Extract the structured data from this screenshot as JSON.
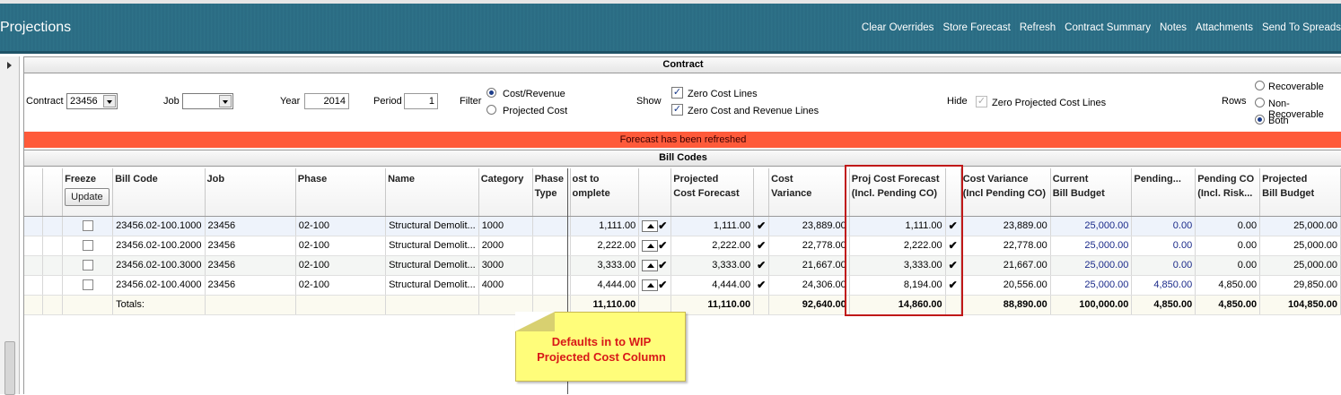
{
  "app": {
    "title": "Projections"
  },
  "header_actions": [
    "Clear Overrides",
    "Store Forecast",
    "Refresh",
    "Contract Summary",
    "Notes",
    "Attachments",
    "Send To Spreads"
  ],
  "contract_section": {
    "title": "Contract",
    "contract_label": "Contract",
    "contract_value": "23456",
    "job_label": "Job",
    "job_value": "",
    "year_label": "Year",
    "year_value": "2014",
    "period_label": "Period",
    "period_value": "1",
    "filter_label": "Filter",
    "filter_options": [
      "Cost/Revenue",
      "Projected Cost"
    ],
    "filter_selected": "Cost/Revenue",
    "show_label": "Show",
    "show_options": [
      "Zero Cost Lines",
      "Zero Cost and Revenue Lines"
    ],
    "hide_label": "Hide",
    "hide_option": "Zero Projected Cost Lines",
    "rows_label": "Rows",
    "rows_options": [
      "Recoverable",
      "Non-Recoverable",
      "Both"
    ],
    "rows_selected": "Both"
  },
  "banner": "Forecast has been refreshed",
  "bill_codes": {
    "title": "Bill Codes",
    "headers": {
      "freeze": "Freeze",
      "update": "Update",
      "bill_code": "Bill Code",
      "job": "Job",
      "phase": "Phase",
      "name": "Name",
      "category": "Category",
      "phase_type_1": "Phase",
      "phase_type_2": "Type",
      "ctc_1": "ost to",
      "ctc_2": "omplete",
      "proj_cost_1": "Projected",
      "proj_cost_2": "Cost Forecast",
      "cost_var_1": "Cost",
      "cost_var_2": "Variance",
      "pcf_1": "Proj Cost Forecast",
      "pcf_2": "(Incl. Pending CO)",
      "cvp_1": "Cost Variance",
      "cvp_2": "(Incl Pending CO)",
      "cbb_1": "Current",
      "cbb_2": "Bill Budget",
      "pending": "Pending...",
      "pco_1": "Pending CO",
      "pco_2": "(Incl. Risk...",
      "pbb_1": "Projected",
      "pbb_2": "Bill Budget"
    },
    "rows": [
      {
        "bill_code": "23456.02-100.1000",
        "job": "23456",
        "phase": "02-100",
        "name": "Structural Demolit...",
        "category": "1000",
        "ctc": "1,111.00",
        "proj_cost": "1,111.00",
        "cost_var": "23,889.00",
        "pcf": "1,111.00",
        "cvp": "23,889.00",
        "cbb": "25,000.00",
        "pending": "0.00",
        "pco": "0.00",
        "pbb": "25,000.00"
      },
      {
        "bill_code": "23456.02-100.2000",
        "job": "23456",
        "phase": "02-100",
        "name": "Structural Demolit...",
        "category": "2000",
        "ctc": "2,222.00",
        "proj_cost": "2,222.00",
        "cost_var": "22,778.00",
        "pcf": "2,222.00",
        "cvp": "22,778.00",
        "cbb": "25,000.00",
        "pending": "0.00",
        "pco": "0.00",
        "pbb": "25,000.00"
      },
      {
        "bill_code": "23456.02-100.3000",
        "job": "23456",
        "phase": "02-100",
        "name": "Structural Demolit...",
        "category": "3000",
        "ctc": "3,333.00",
        "proj_cost": "3,333.00",
        "cost_var": "21,667.00",
        "pcf": "3,333.00",
        "cvp": "21,667.00",
        "cbb": "25,000.00",
        "pending": "0.00",
        "pco": "0.00",
        "pbb": "25,000.00"
      },
      {
        "bill_code": "23456.02-100.4000",
        "job": "23456",
        "phase": "02-100",
        "name": "Structural Demolit...",
        "category": "4000",
        "ctc": "4,444.00",
        "proj_cost": "4,444.00",
        "cost_var": "24,306.00",
        "pcf": "8,194.00",
        "cvp": "20,556.00",
        "cbb": "25,000.00",
        "pending": "4,850.00",
        "pco": "4,850.00",
        "pbb": "29,850.00"
      }
    ],
    "totals": {
      "label": "Totals:",
      "ctc": "11,110.00",
      "proj_cost": "11,110.00",
      "cost_var": "92,640.00",
      "pcf": "14,860.00",
      "cvp": "88,890.00",
      "cbb": "100,000.00",
      "pending": "4,850.00",
      "pco": "4,850.00",
      "pbb": "104,850.00"
    }
  },
  "callout": {
    "line1": "Defaults in to WIP",
    "line2": "Projected Cost Column"
  },
  "colors": {
    "header": "#2d7087",
    "banner": "#ff5a3a",
    "highlight_box": "#c01818",
    "callout": "#fffd7a"
  }
}
